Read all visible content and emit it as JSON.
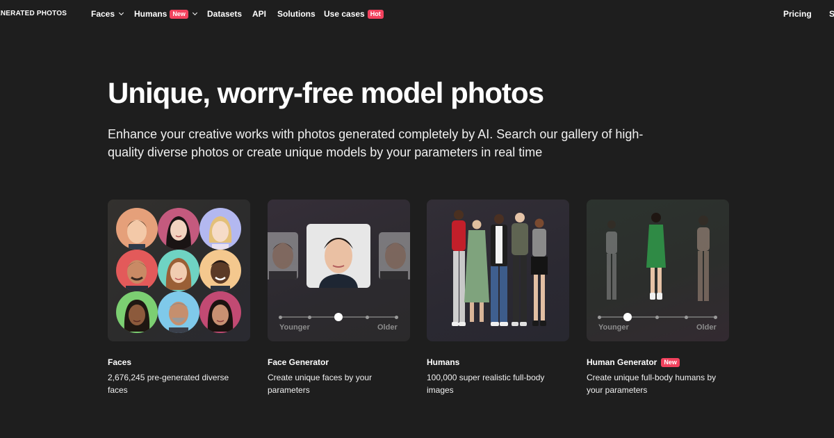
{
  "nav": {
    "logo": "ENERATED PHOTOS",
    "items": [
      {
        "label": "Faces",
        "has_chevron": true
      },
      {
        "label": "Humans",
        "badge": "New",
        "has_chevron": true
      },
      {
        "label": "Datasets"
      },
      {
        "label": "API"
      },
      {
        "label": "Solutions"
      },
      {
        "label": "Use cases",
        "badge": "Hot"
      }
    ],
    "pricing": "Pricing",
    "cut_item": "S"
  },
  "hero": {
    "title": "Unique, worry-free model photos",
    "subtitle": "Enhance your creative works with photos generated completely by AI. Search our gallery of high-quality diverse photos or create unique models by your parameters in real time"
  },
  "cards": [
    {
      "title": "Faces",
      "description": "2,676,245 pre-generated diverse faces"
    },
    {
      "title": "Face Generator",
      "description": "Create unique faces by your parameters",
      "slider": {
        "min_label": "Younger",
        "max_label": "Older"
      }
    },
    {
      "title": "Humans",
      "description": "100,000 super realistic full-body images"
    },
    {
      "title": "Human Generator",
      "badge": "New",
      "description": "Create unique full-body humans by your parameters",
      "slider": {
        "min_label": "Younger",
        "max_label": "Older"
      }
    }
  ],
  "colors": {
    "background": "#1e1e1e",
    "badge": "#f2425e",
    "text": "#ffffff",
    "slider_label": "#8c8c8c"
  }
}
